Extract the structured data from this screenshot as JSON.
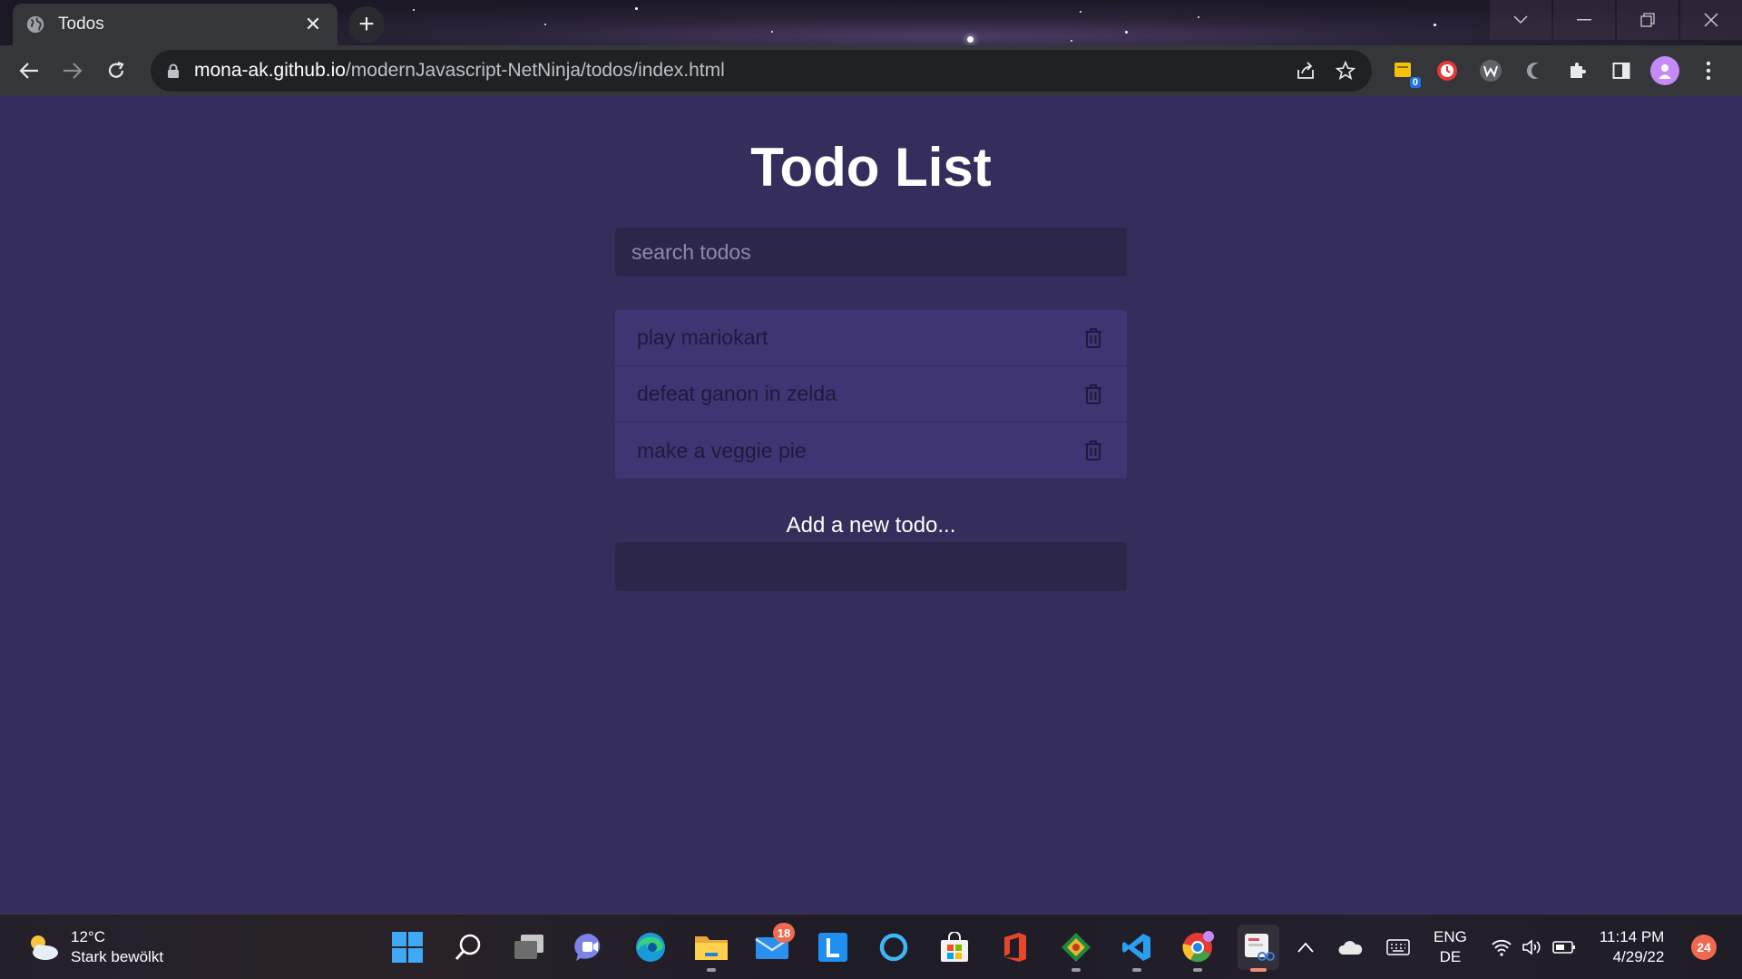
{
  "browser": {
    "tab_title": "Todos",
    "tab_close": "✕",
    "new_tab": "+",
    "url_host": "mona-ak.github.io",
    "url_path": "/modernJavascript-NetNinja/todos/index.html",
    "extension_badge": "0",
    "window_controls": [
      "tab-search",
      "minimize",
      "restore",
      "close"
    ]
  },
  "page": {
    "title": "Todo List",
    "search_placeholder": "search todos",
    "todos": [
      {
        "text": "play mariokart"
      },
      {
        "text": "defeat ganon in zelda"
      },
      {
        "text": "make a veggie pie"
      }
    ],
    "add_label": "Add a new todo...",
    "add_value": ""
  },
  "taskbar": {
    "weather_temp": "12°C",
    "weather_desc": "Stark bewölkt",
    "mail_badge": "18",
    "lang_line1": "ENG",
    "lang_line2": "DE",
    "time": "11:14 PM",
    "date": "4/29/22",
    "notifications": "24"
  },
  "colors": {
    "page_bg": "#352e5c",
    "todo_bg": "#3f3572",
    "input_bg": "#2c2748",
    "chrome_bg": "#35363a"
  }
}
